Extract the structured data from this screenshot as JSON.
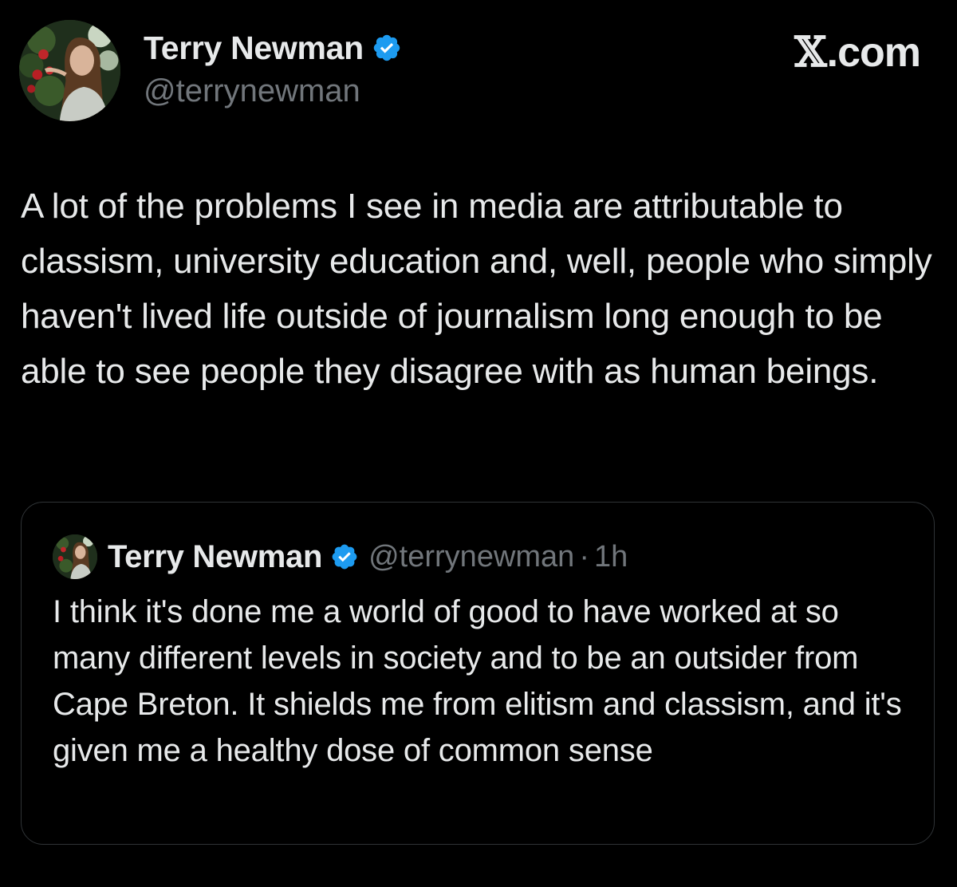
{
  "tweet": {
    "author": {
      "name": "Terry Newman",
      "handle": "@terrynewman",
      "verified": true,
      "verified_color": "#1d9bf0"
    },
    "brand": {
      "x_glyph": "𝕏",
      "suffix": ".com"
    },
    "text": "A lot of the problems I see in media are attributable to classism, university education and, well, people who simply haven't lived life outside of journalism long enough to be able to see people they disagree with as human beings."
  },
  "quoted_tweet": {
    "author": {
      "name": "Terry Newman",
      "handle": "@terrynewman",
      "verified": true
    },
    "separator": "·",
    "time": "1h",
    "text": "I think it's done me a world of good to have worked at so many different levels in society and to be an outsider from Cape Breton. It shields me from elitism and classism, and it's given me a healthy dose of common sense"
  },
  "colors": {
    "background": "#000000",
    "primary_text": "#e7e9ea",
    "secondary_text": "#71767b",
    "border": "#2f3336",
    "accent": "#1d9bf0"
  },
  "icons": {
    "avatar": "profile-photo-avatar",
    "verified": "verified-badge-icon"
  }
}
